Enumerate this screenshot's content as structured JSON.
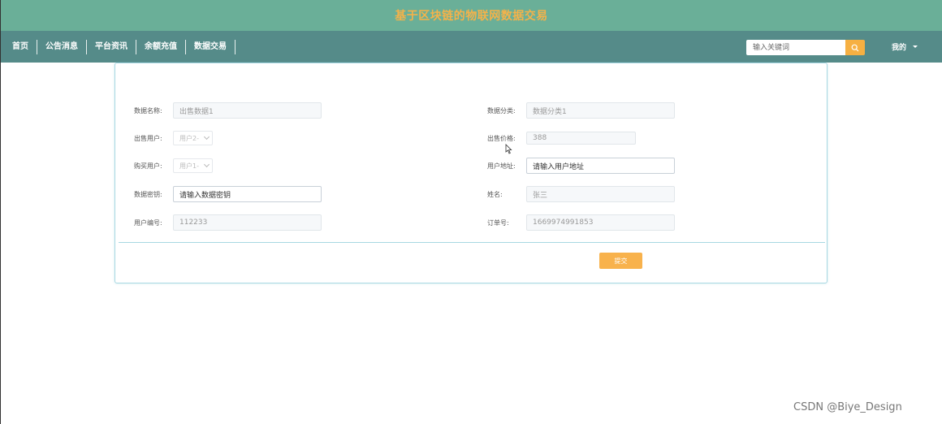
{
  "banner": {
    "title": "基于区块链的物联网数据交易"
  },
  "nav": {
    "items": [
      "首页",
      "公告消息",
      "平台资讯",
      "余额充值",
      "数据交易"
    ]
  },
  "search": {
    "placeholder": "输入关键词",
    "icon": "search-icon"
  },
  "user_menu": {
    "label": "我的"
  },
  "form": {
    "data_name": {
      "label": "数据名称:",
      "value": "出售数据1"
    },
    "data_category": {
      "label": "数据分类:",
      "value": "数据分类1"
    },
    "seller": {
      "label": "出售用户:",
      "value": "用户2-"
    },
    "sale_price": {
      "label": "出售价格:",
      "value": "388"
    },
    "buyer": {
      "label": "购买用户:",
      "value": "用户1-"
    },
    "user_address": {
      "label": "用户地址:",
      "placeholder": "请输入用户地址"
    },
    "data_key": {
      "label": "数据密钥:",
      "placeholder": "请输入数据密钥"
    },
    "name": {
      "label": "姓名:",
      "value": "张三"
    },
    "user_id": {
      "label": "用户编号:",
      "value": "112233"
    },
    "order_no": {
      "label": "订单号:",
      "value": "1669974991853"
    },
    "submit_label": "提交"
  },
  "watermark": "CSDN @Biye_Design",
  "colors": {
    "banner": "#6aaf98",
    "navbar": "#558b89",
    "accent": "#f6b042",
    "title": "#f4b24a"
  }
}
